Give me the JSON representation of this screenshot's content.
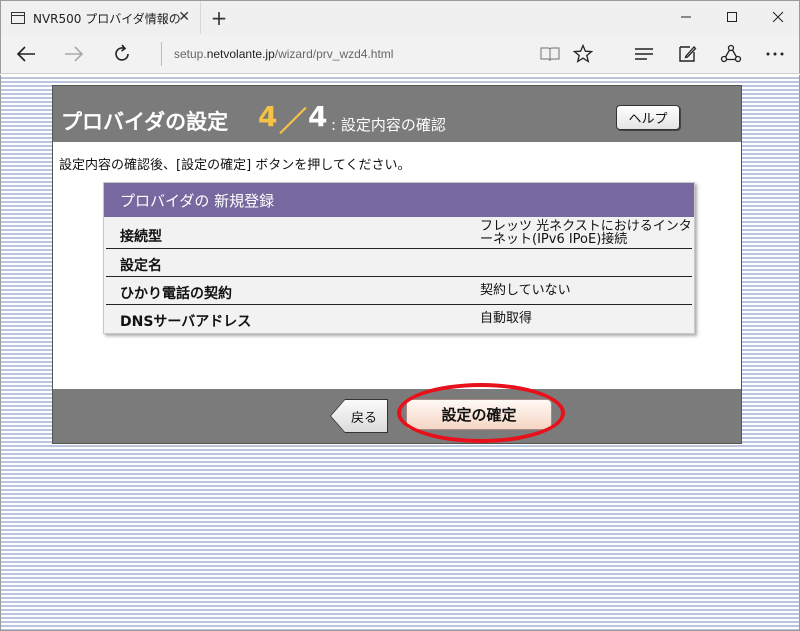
{
  "browser": {
    "tab_title": "NVR500 プロバイダ情報の",
    "tab_close": "✕",
    "new_tab": "+",
    "url_prefix": "setup.",
    "url_host": "netvolante.jp",
    "url_path": "/wizard/prv_wzd4.html",
    "icons": {
      "back": "arrow-left-icon",
      "forward": "arrow-right-icon",
      "refresh": "refresh-icon",
      "reading": "book-icon",
      "favorite": "star-icon",
      "hub": "hub-icon",
      "note": "note-icon",
      "share": "share-icon",
      "more": "more-icon"
    }
  },
  "header": {
    "title": "プロバイダの設定",
    "step": "4",
    "slash": "／",
    "total": "4",
    "subtitle": ": 設定内容の確認",
    "help_label": "ヘルプ"
  },
  "instruction": "設定内容の確認後、[設定の確定] ボタンを押してください。",
  "registration": {
    "heading": "プロバイダの 新規登録",
    "rows": [
      {
        "label": "接続型",
        "value": "フレッツ 光ネクストにおけるインターネット(IPv6 IPoE)接続"
      },
      {
        "label": "設定名",
        "value": ""
      },
      {
        "label": "ひかり電話の契約",
        "value": "契約していない"
      },
      {
        "label": "DNSサーバアドレス",
        "value": "自動取得"
      }
    ]
  },
  "footer": {
    "back_label": "戻る",
    "confirm_label": "設定の確定"
  },
  "colors": {
    "header_gray": "#7b7b7b",
    "step_yellow": "#f6c344",
    "section_purple": "#77699f",
    "highlight_red": "#e8101a"
  }
}
